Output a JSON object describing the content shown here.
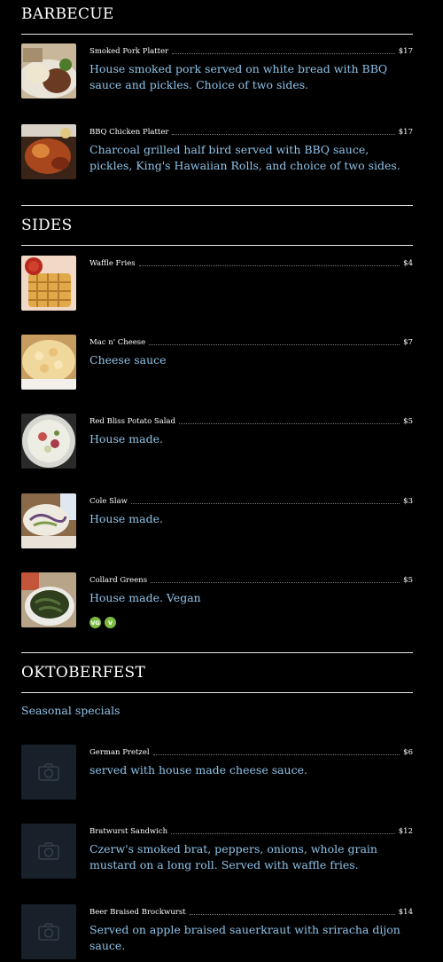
{
  "sections": [
    {
      "title": "BARBECUE",
      "items": [
        {
          "name": "Smoked Pork Platter",
          "price": "$17",
          "desc": "House smoked pork served on white bread with BBQ sauce and pickles. Choice of two sides."
        },
        {
          "name": "BBQ Chicken Platter",
          "price": "$17",
          "desc": "Charcoal grilled half bird served with BBQ sauce, pickles, King's Hawaiian Rolls, and choice of two sides."
        }
      ]
    },
    {
      "title": "SIDES",
      "items": [
        {
          "name": "Waffle Fries",
          "price": "$4",
          "desc": ""
        },
        {
          "name": "Mac n' Cheese",
          "price": "$7",
          "desc": "Cheese sauce"
        },
        {
          "name": "Red Bliss Potato Salad",
          "price": "$5",
          "desc": "House made."
        },
        {
          "name": "Cole Slaw",
          "price": "$3",
          "desc": "House made."
        },
        {
          "name": "Collard Greens",
          "price": "$5",
          "desc": "House made. Vegan",
          "badges": [
            "VG",
            "V"
          ]
        }
      ]
    },
    {
      "title": "OKTOBERFEST",
      "description": "Seasonal specials",
      "items": [
        {
          "name": "German Pretzel",
          "price": "$6",
          "desc": "served with house made cheese sauce."
        },
        {
          "name": "Bratwurst Sandwich",
          "price": "$12",
          "desc": "Czerw's smoked brat, peppers, onions, whole grain mustard on a long roll. Served with waffle fries."
        },
        {
          "name": "Beer Braised Brockwurst",
          "price": "$14",
          "desc": "Served on apple braised sauerkraut with sriracha dijon sauce."
        }
      ]
    }
  ],
  "icons": {
    "photo_placeholder": "camera-icon",
    "vegan_badge": "vegan-icon",
    "vegetarian_badge": "vegetarian-icon"
  },
  "colors": {
    "background": "#000000",
    "description": "#8fc3e8",
    "badge": "#7dbb43",
    "placeholder": "#18202a"
  }
}
